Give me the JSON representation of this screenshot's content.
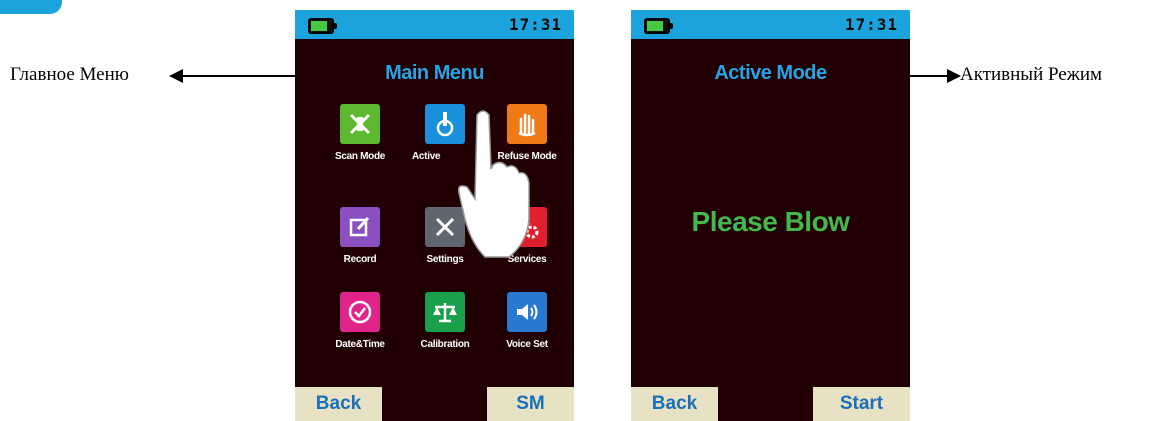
{
  "annotations": {
    "left_label": "Главное Меню",
    "right_label": "Активный Режим"
  },
  "main_screen": {
    "time": "17:31",
    "title": "Main Menu",
    "menu": [
      {
        "label": "Scan Mode",
        "icon": "scan-mode-icon",
        "color": "#5cb82e"
      },
      {
        "label": "Active",
        "icon": "active-mode-icon",
        "color": "#1a8fdc"
      },
      {
        "label": "Refuse Mode",
        "icon": "refuse-hand-icon",
        "color": "#f07a16"
      },
      {
        "label": "Record",
        "icon": "record-edit-icon",
        "color": "#8a4fc0"
      },
      {
        "label": "Settings",
        "icon": "settings-tools-icon",
        "color": "#606670"
      },
      {
        "label": "Services",
        "icon": "gears-icon",
        "color": "#e0202a"
      },
      {
        "label": "Date&Time",
        "icon": "clock-icon",
        "color": "#e0248a"
      },
      {
        "label": "Calibration",
        "icon": "scale-icon",
        "color": "#1aa04a"
      },
      {
        "label": "Voice Set",
        "icon": "speaker-icon",
        "color": "#2a78d0"
      }
    ],
    "softkey_left": "Back",
    "softkey_right": "SM"
  },
  "active_screen": {
    "time": "17:31",
    "title": "Active Mode",
    "message": "Please Blow",
    "softkey_left": "Back",
    "softkey_right": "Start"
  },
  "colors": {
    "status_bar": "#1aa3dc",
    "screen_bg": "#200000",
    "title": "#2aa3e6",
    "message": "#45b84a",
    "softkey_bg": "#e8e2c4",
    "softkey_text": "#1b6fb8"
  }
}
